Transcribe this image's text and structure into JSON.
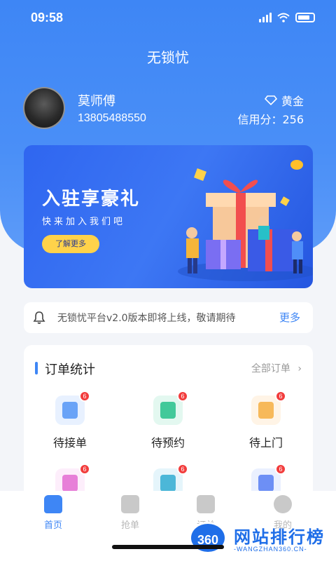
{
  "status": {
    "time": "09:58"
  },
  "app": {
    "title": "无锁忧"
  },
  "user": {
    "name": "莫师傅",
    "phone": "13805488550",
    "level": "黄金",
    "credit": "信用分：256"
  },
  "banner": {
    "title": "入驻享豪礼",
    "subtitle": "快来加入我们吧",
    "button": "了解更多"
  },
  "notice": {
    "text": "无锁忧平台v2.0版本即将上线，敬请期待",
    "more": "更多"
  },
  "orders": {
    "title": "订单统计",
    "all_label": "全部订单",
    "items": [
      {
        "label": "待接单",
        "badge": "6"
      },
      {
        "label": "待预约",
        "badge": "6"
      },
      {
        "label": "待上门",
        "badge": "6"
      },
      {
        "label": "",
        "badge": "6"
      },
      {
        "label": "",
        "badge": "6"
      },
      {
        "label": "",
        "badge": "6"
      }
    ]
  },
  "tabbar": {
    "items": [
      {
        "label": "首页"
      },
      {
        "label": "抢单"
      },
      {
        "label": "订单"
      },
      {
        "label": "我的"
      }
    ]
  },
  "watermark": {
    "logo": "360",
    "text": "网站排行榜",
    "url": "-WANGZHAN360.CN-"
  },
  "colors": {
    "primary": "#3e86f5",
    "badge": "#f23c3c",
    "banner_button": "#ffd24a"
  }
}
